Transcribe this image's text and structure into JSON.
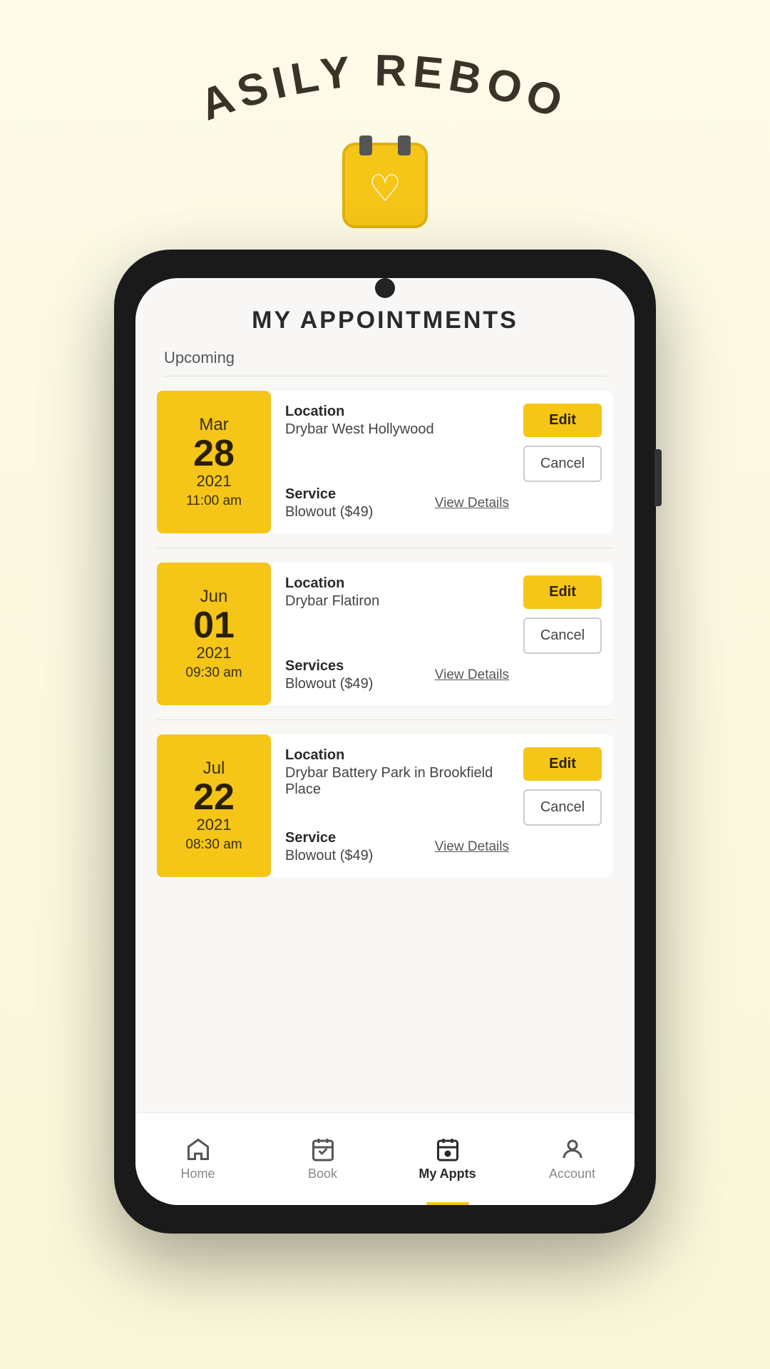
{
  "header": {
    "arc_text": "EASILY REBOOK",
    "calendar_icon": "calendar-heart-icon"
  },
  "page": {
    "title": "MY APPOINTMENTS",
    "section_upcoming": "Upcoming"
  },
  "appointments": [
    {
      "id": 1,
      "month": "Mar",
      "day": "28",
      "year": "2021",
      "time": "11:00 am",
      "location_label": "Location",
      "location": "Drybar West Hollywood",
      "service_label": "Service",
      "service": "Blowout ($49)",
      "edit_label": "Edit",
      "cancel_label": "Cancel",
      "view_details_label": "View Details"
    },
    {
      "id": 2,
      "month": "Jun",
      "day": "01",
      "year": "2021",
      "time": "09:30 am",
      "location_label": "Location",
      "location": "Drybar Flatiron",
      "service_label": "Services",
      "service": "Blowout ($49)",
      "edit_label": "Edit",
      "cancel_label": "Cancel",
      "view_details_label": "View Details"
    },
    {
      "id": 3,
      "month": "Jul",
      "day": "22",
      "year": "2021",
      "time": "08:30 am",
      "location_label": "Location",
      "location": "Drybar Battery Park in Brookfield Place",
      "service_label": "Service",
      "service": "Blowout ($49)",
      "edit_label": "Edit",
      "cancel_label": "Cancel",
      "view_details_label": "View Details"
    }
  ],
  "nav": {
    "home_label": "Home",
    "book_label": "Book",
    "my_appts_label": "My Appts",
    "account_label": "Account"
  },
  "colors": {
    "yellow": "#f5c518",
    "dark": "#2a2a2a",
    "accent": "#3a3428"
  }
}
